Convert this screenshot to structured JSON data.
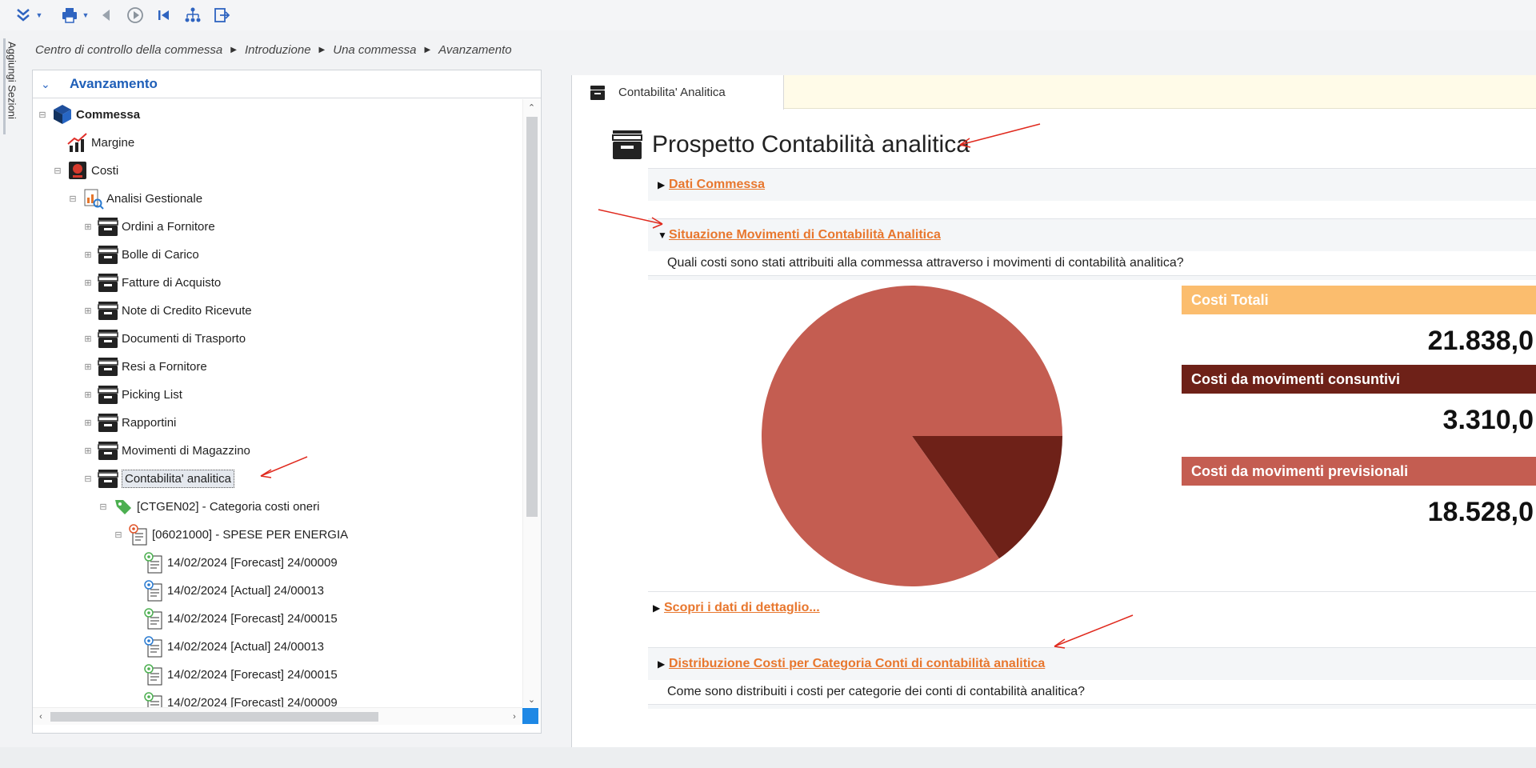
{
  "toolbar": {
    "icons": [
      "collapse-icon",
      "print-icon",
      "back-icon",
      "play-icon",
      "first-icon",
      "hierarchy-icon",
      "exit-icon"
    ]
  },
  "side_tab": {
    "label": "Aggiungi Sezioni"
  },
  "breadcrumb": {
    "items": [
      "Centro di controllo della commessa",
      "Introduzione",
      "Una commessa",
      "Avanzamento"
    ]
  },
  "tree": {
    "title": "Avanzamento",
    "items": [
      {
        "label": "Commessa",
        "icon": "cube-icon"
      },
      {
        "label": "Margine",
        "icon": "chart-up-icon"
      },
      {
        "label": "Costi",
        "icon": "costs-icon"
      },
      {
        "label": "Analisi Gestionale",
        "icon": "analysis-icon"
      },
      {
        "label": "Ordini a Fornitore",
        "icon": "drawer-icon"
      },
      {
        "label": "Bolle di Carico",
        "icon": "drawer-icon"
      },
      {
        "label": "Fatture di Acquisto",
        "icon": "drawer-icon"
      },
      {
        "label": "Note di Credito Ricevute",
        "icon": "drawer-icon"
      },
      {
        "label": "Documenti di Trasporto",
        "icon": "drawer-icon"
      },
      {
        "label": "Resi a Fornitore",
        "icon": "drawer-icon"
      },
      {
        "label": "Picking List",
        "icon": "drawer-icon"
      },
      {
        "label": "Rapportini",
        "icon": "drawer-icon"
      },
      {
        "label": "Movimenti di Magazzino",
        "icon": "drawer-icon"
      },
      {
        "label": "Contabilita' analitica",
        "icon": "drawer-icon"
      },
      {
        "label": "[CTGEN02] - Categoria costi oneri",
        "icon": "tag-icon"
      },
      {
        "label": "[06021000] - SPESE PER ENERGIA",
        "icon": "document-gear-icon"
      },
      {
        "label": "14/02/2024 [Forecast] 24/00009",
        "icon": "doc-forecast-icon"
      },
      {
        "label": "14/02/2024 [Actual] 24/00013",
        "icon": "doc-actual-icon"
      },
      {
        "label": "14/02/2024 [Forecast] 24/00015",
        "icon": "doc-forecast-icon"
      },
      {
        "label": "14/02/2024 [Actual] 24/00013",
        "icon": "doc-actual-icon"
      },
      {
        "label": "14/02/2024 [Forecast] 24/00015",
        "icon": "doc-forecast-icon"
      },
      {
        "label": "14/02/2024 [Forecast] 24/00009",
        "icon": "doc-forecast-icon"
      }
    ]
  },
  "tab": {
    "label": "Contabilita' Analitica"
  },
  "page": {
    "title": "Prospetto Contabilità analitica"
  },
  "sections": {
    "dati_commessa": "Dati Commessa",
    "situazione": "Situazione Movimenti di Contabilità Analitica",
    "situazione_question": "Quali costi sono stati attribuiti alla commessa attraverso i movimenti di contabilità analitica?",
    "scopri": "Scopri i dati di dettaglio...",
    "distribuzione": "Distribuzione Costi per Categoria Conti di contabilità analitica",
    "distribuzione_question": "Come sono distribuiti i costi per categorie dei conti di contabilità analitica?"
  },
  "kpis": [
    {
      "label": "Costi Totali",
      "value": "21.838,0",
      "color": "#fbbd6e",
      "text_color": "#ffffff"
    },
    {
      "label": "Costi da movimenti consuntivi",
      "value": "3.310,0",
      "color": "#6e2118",
      "text_color": "#ffffff"
    },
    {
      "label": "Costi da movimenti previsionali",
      "value": "18.528,0",
      "color": "#c45d51",
      "text_color": "#ffffff"
    }
  ],
  "chart_data": {
    "type": "pie",
    "slices": [
      {
        "label": "Costi da movimenti consuntivi",
        "value": 3310,
        "color": "#6e2118"
      },
      {
        "label": "Costi da movimenti previsionali",
        "value": 18528,
        "color": "#c45d51"
      }
    ]
  }
}
